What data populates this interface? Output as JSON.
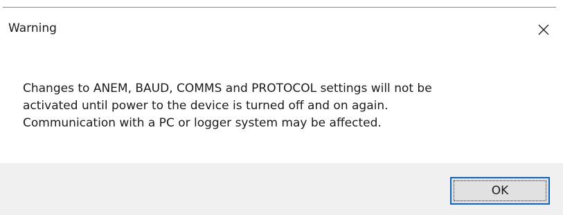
{
  "window": {
    "title": "Warning",
    "close_icon": "close-icon"
  },
  "message": {
    "lines": [
      "Changes to ANEM, BAUD, COMMS and PROTOCOL settings will not be",
      "activated until power to the device is turned off and on again.",
      "Communication with a PC or logger system may be affected."
    ]
  },
  "buttons": {
    "ok_label": "OK"
  },
  "colors": {
    "footer_background": "#f0f0f0",
    "button_focus_border": "#0a64c8",
    "button_background": "#e1e1e1"
  }
}
